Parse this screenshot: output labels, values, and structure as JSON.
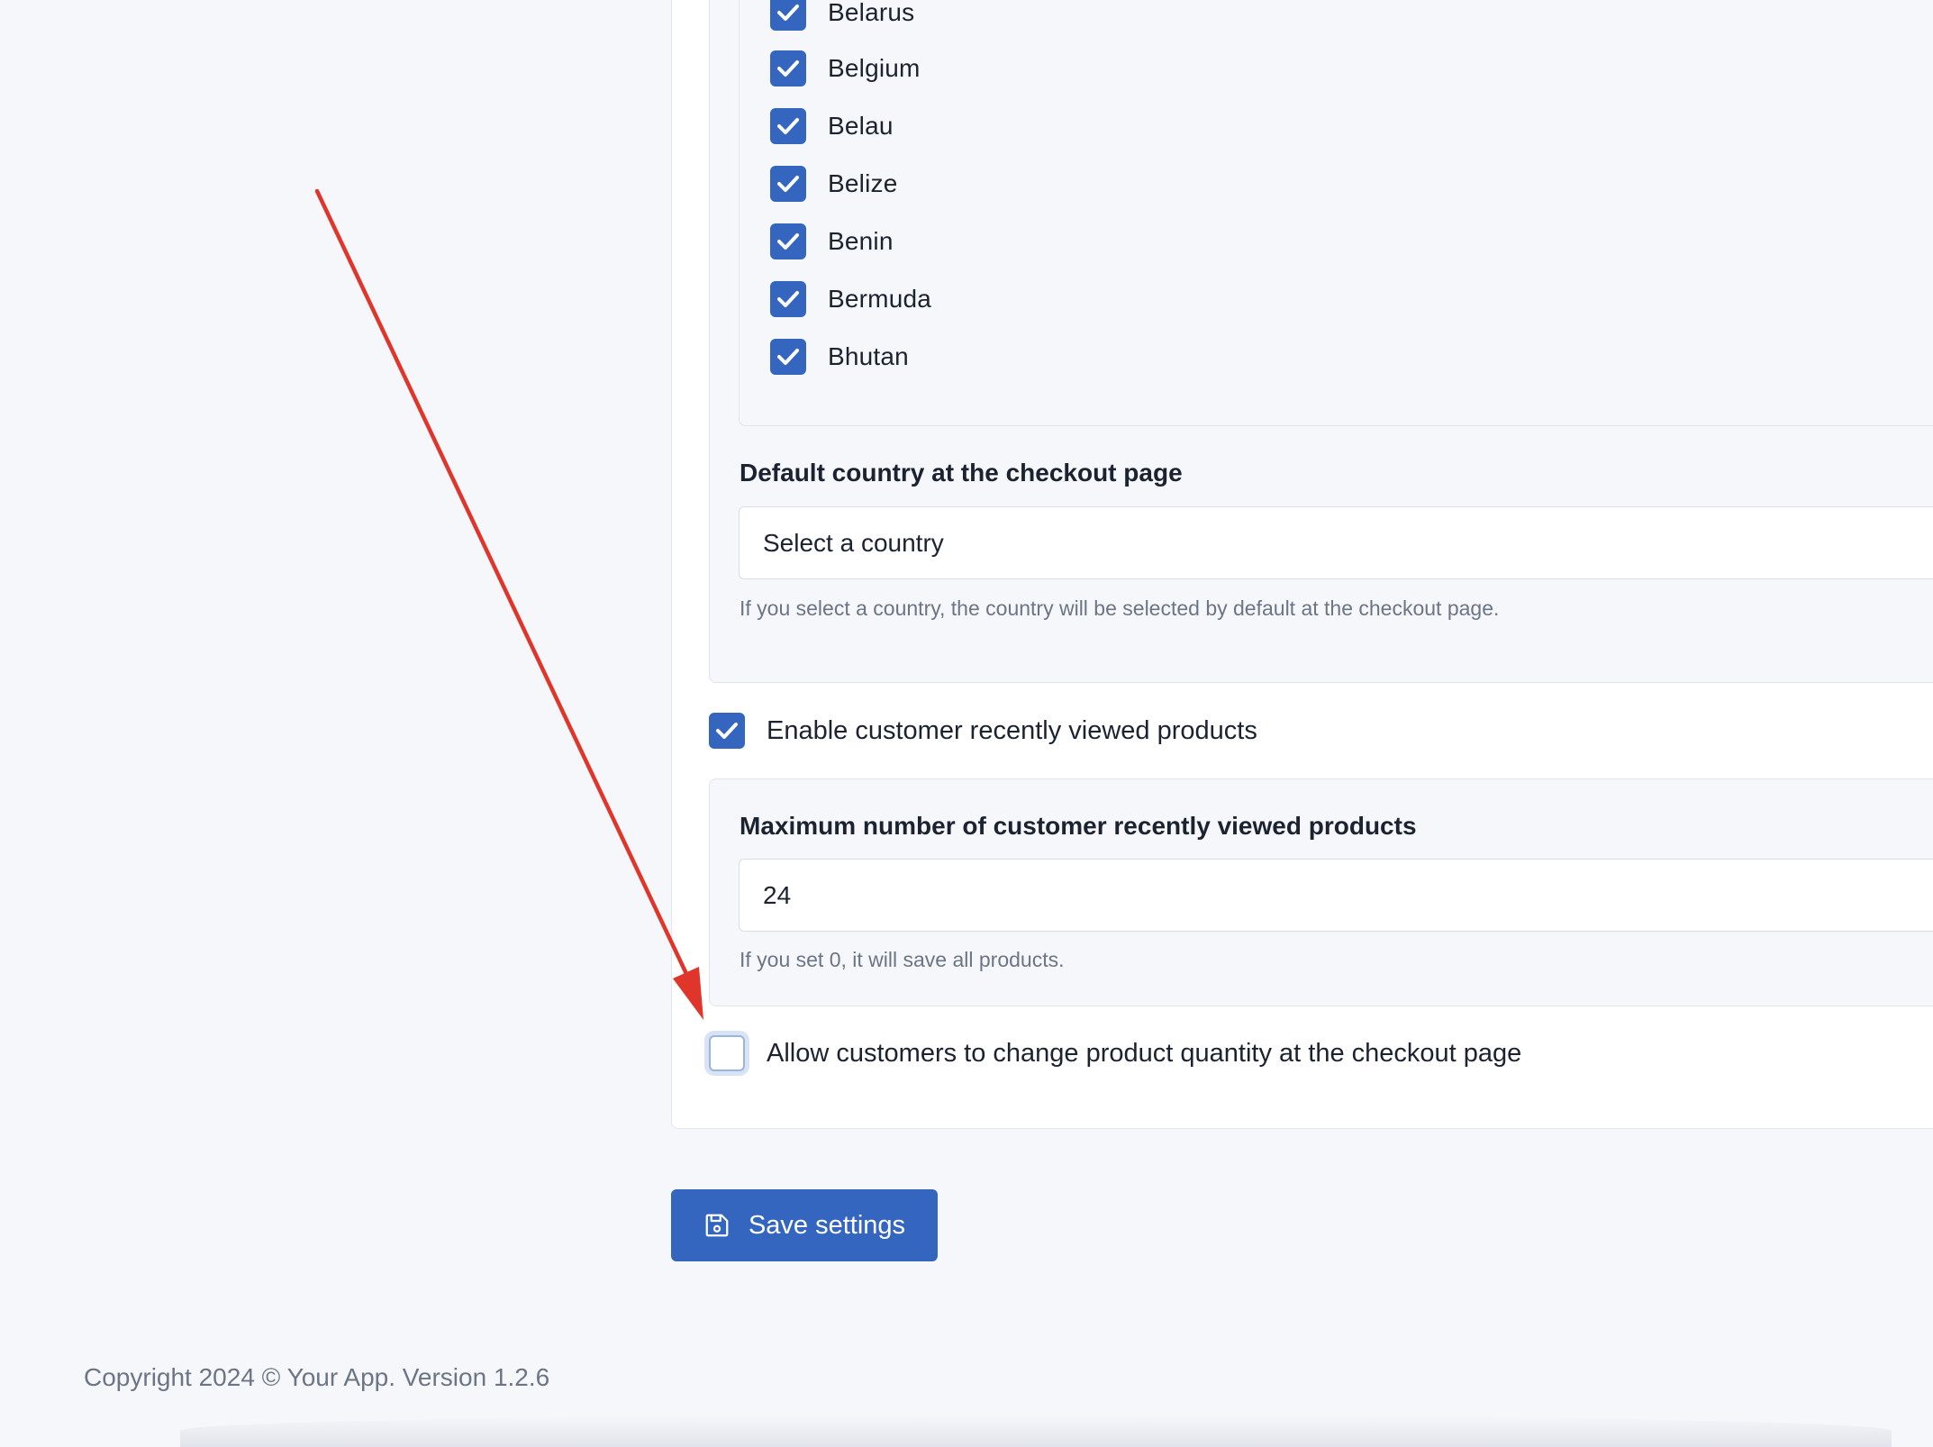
{
  "countries": [
    {
      "label": "Belarus",
      "checked": true
    },
    {
      "label": "Belgium",
      "checked": true
    },
    {
      "label": "Belau",
      "checked": true
    },
    {
      "label": "Belize",
      "checked": true
    },
    {
      "label": "Benin",
      "checked": true
    },
    {
      "label": "Bermuda",
      "checked": true
    },
    {
      "label": "Bhutan",
      "checked": true
    }
  ],
  "default_country": {
    "label": "Default country at the checkout page",
    "select_value": "Select a country",
    "help": "If you select a country, the country will be selected by default at the checkout page."
  },
  "recently_viewed": {
    "enable_label": "Enable customer recently viewed products",
    "enabled": true,
    "max_label": "Maximum number of customer recently viewed products",
    "max_value": "24",
    "help": "If you set 0, it will save all products."
  },
  "quantity_option": {
    "label": "Allow customers to change product quantity at the checkout page",
    "checked": false
  },
  "save_button": {
    "label": "Save settings",
    "icon": "floppy-disk-icon"
  },
  "footer": {
    "text": "Copyright 2024 © Your App. Version 1.2.6"
  },
  "colors": {
    "accent": "#3466c0",
    "annotation_arrow": "#e0352b"
  }
}
